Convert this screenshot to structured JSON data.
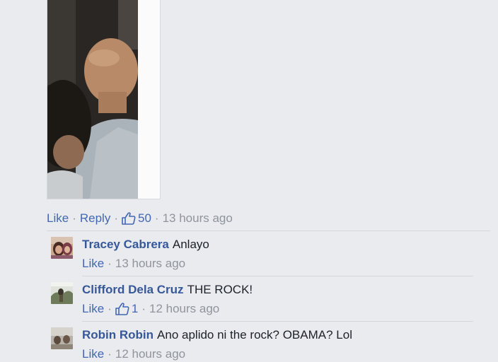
{
  "post": {
    "actions": {
      "like_label": "Like",
      "reply_label": "Reply",
      "like_count": "50",
      "time": "13 hours ago",
      "separator": "·"
    }
  },
  "replies": [
    {
      "author": "Tracey Cabrera",
      "text": "Anlayo",
      "like_label": "Like",
      "like_count": "",
      "time": "13 hours ago"
    },
    {
      "author": "Clifford Dela Cruz",
      "text": "THE ROCK!",
      "like_label": "Like",
      "like_count": "1",
      "time": "12 hours ago"
    },
    {
      "author": "Robin Robin",
      "text": "Ano aplido ni the rock? OBAMA? Lol",
      "like_label": "Like",
      "like_count": "",
      "time": "12 hours ago"
    }
  ],
  "colors": {
    "link": "#4267b2",
    "author": "#365899",
    "muted": "#90949c",
    "background": "#e9ebee"
  },
  "icons": {
    "like_count_icon": "thumbs-up-outline-icon"
  }
}
